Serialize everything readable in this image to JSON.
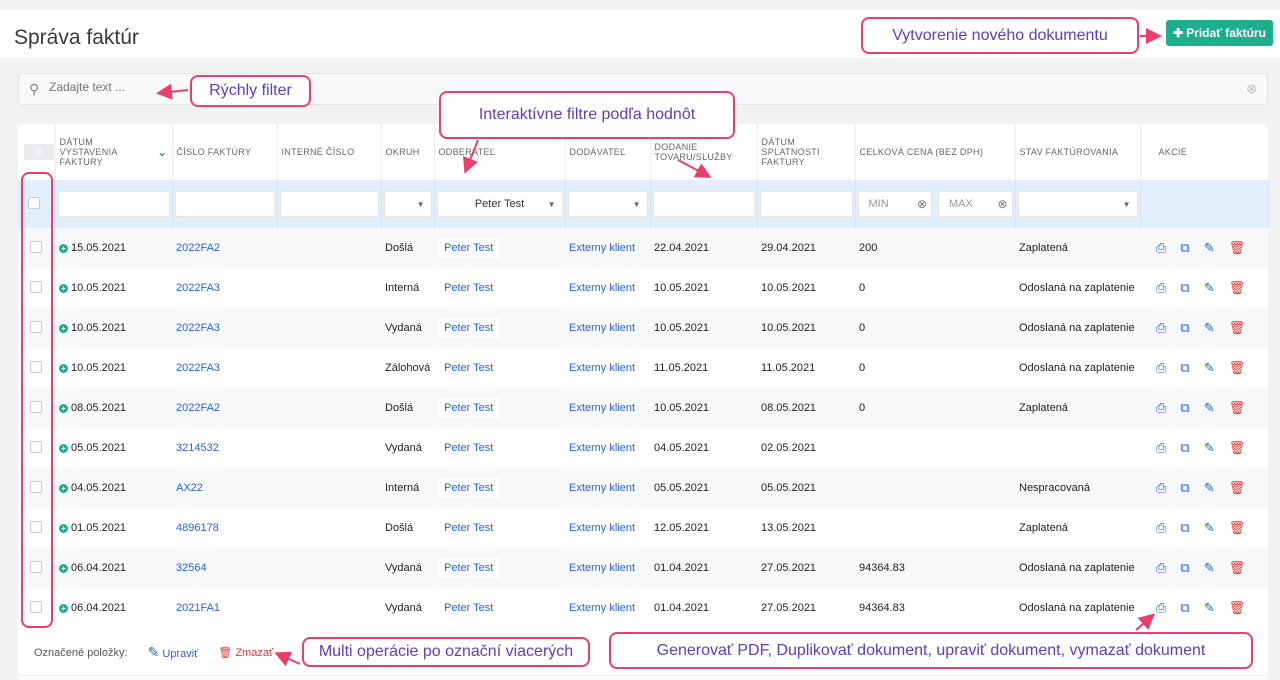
{
  "header": {
    "title": "Správa faktúr",
    "add_button": "Pridať faktúru"
  },
  "search": {
    "placeholder": "Zadajte text ..."
  },
  "table": {
    "selected_count": "0",
    "columns": [
      "DÁTUM VYSTAVENIA FAKTURY",
      "ČÍSLO FAKTÚRY",
      "INTERNÉ ČÍSLO",
      "OKRUH",
      "ODBERATEĽ",
      "DODÁVATEĽ",
      "DODANIE TOVARU/SLUŽBY",
      "DÁTUM SPLATNOSTI FAKTURY",
      "CELKOVÁ CENA (BEZ DPH)",
      "STAV FAKTÚROVANIA",
      "AKCIE"
    ],
    "filters": {
      "odberatel": "Peter Test",
      "min_placeholder": "MIN",
      "max_placeholder": "MAX"
    },
    "rows": [
      {
        "date": "15.05.2021",
        "number": "2022FA2",
        "internal": "",
        "okruh": "Došlá",
        "odberatel": "Peter Test",
        "dodavatel": "Externy klient",
        "dodanie": "22.04.2021",
        "splatnost": "29.04.2021",
        "cena": "200",
        "stav": "Zaplatená"
      },
      {
        "date": "10.05.2021",
        "number": "2022FA3",
        "internal": "",
        "okruh": "Interná",
        "odberatel": "Peter Test",
        "dodavatel": "Externy klient",
        "dodanie": "10.05.2021",
        "splatnost": "10.05.2021",
        "cena": "0",
        "stav": "Odoslaná na zaplatenie"
      },
      {
        "date": "10.05.2021",
        "number": "2022FA3",
        "internal": "",
        "okruh": "Vydaná",
        "odberatel": "Peter Test",
        "dodavatel": "Externy klient",
        "dodanie": "10.05.2021",
        "splatnost": "10.05.2021",
        "cena": "0",
        "stav": "Odoslaná na zaplatenie"
      },
      {
        "date": "10.05.2021",
        "number": "2022FA3",
        "internal": "",
        "okruh": "Zálohová",
        "odberatel": "Peter Test",
        "dodavatel": "Externy klient",
        "dodanie": "11.05.2021",
        "splatnost": "11.05.2021",
        "cena": "0",
        "stav": "Odoslaná na zaplatenie"
      },
      {
        "date": "08.05.2021",
        "number": "2022FA2",
        "internal": "",
        "okruh": "Došlá",
        "odberatel": "Peter Test",
        "dodavatel": "Externy klient",
        "dodanie": "10.05.2021",
        "splatnost": "08.05.2021",
        "cena": "0",
        "stav": "Zaplatená"
      },
      {
        "date": "05.05.2021",
        "number": "3214532",
        "internal": "",
        "okruh": "Vydaná",
        "odberatel": "Peter Test",
        "dodavatel": "Externy klient",
        "dodanie": "04.05.2021",
        "splatnost": "02.05.2021",
        "cena": "",
        "stav": ""
      },
      {
        "date": "04.05.2021",
        "number": "AX22",
        "internal": "",
        "okruh": "Interná",
        "odberatel": "Peter Test",
        "dodavatel": "Externy klient",
        "dodanie": "05.05.2021",
        "splatnost": "05.05.2021",
        "cena": "",
        "stav": "Nespracovaná"
      },
      {
        "date": "01.05.2021",
        "number": "4896178",
        "internal": "",
        "okruh": "Došlá",
        "odberatel": "Peter Test",
        "dodavatel": "Externy klient",
        "dodanie": "12.05.2021",
        "splatnost": "13.05.2021",
        "cena": "",
        "stav": "Zaplatená"
      },
      {
        "date": "06.04.2021",
        "number": "32564",
        "internal": "",
        "okruh": "Vydaná",
        "odberatel": "Peter Test",
        "dodavatel": "Externy klient",
        "dodanie": "01.04.2021",
        "splatnost": "27.05.2021",
        "cena": "94364.83",
        "stav": "Odoslaná na zaplatenie"
      },
      {
        "date": "06.04.2021",
        "number": "2021FA1",
        "internal": "",
        "okruh": "Vydaná",
        "odberatel": "Peter Test",
        "dodavatel": "Externy klient",
        "dodanie": "01.04.2021",
        "splatnost": "27.05.2021",
        "cena": "94364.83",
        "stav": "Odoslaná na zaplatenie"
      }
    ]
  },
  "footer": {
    "label": "Označené položky:",
    "edit": "Upraviť",
    "delete": "Zmazať"
  },
  "annotations": {
    "new_doc": "Vytvorenie nového dokumentu",
    "quick_filter": "Rýchly filter",
    "interactive_filters": "Interaktívne filtre podľa hodnôt",
    "multi_ops": "Multi operácie po označní viacerých",
    "row_actions": "Generovať PDF, Duplikovať dokument, upraviť dokument, vymazať dokument"
  },
  "colors": {
    "accent": "#1fae8c",
    "link": "#2a62d6",
    "annotation_border": "#e8406e",
    "annotation_text": "#5a3fc0",
    "delete": "#e53935"
  }
}
